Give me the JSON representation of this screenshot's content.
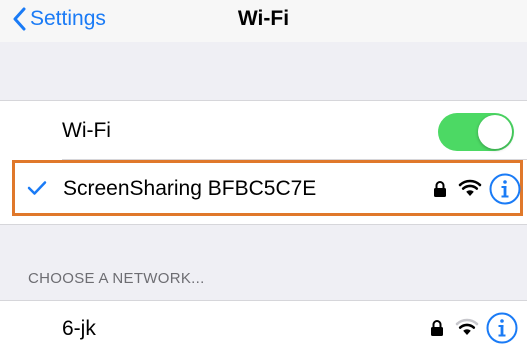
{
  "nav": {
    "back_label": "Settings",
    "title": "Wi-Fi"
  },
  "wifi_toggle": {
    "label": "Wi-Fi",
    "on": true,
    "color": "#4cd964"
  },
  "connected_network": {
    "name": "ScreenSharing BFBC5C7E",
    "secured": true,
    "icons": [
      "checkmark-icon",
      "lock-icon",
      "wifi-signal-icon",
      "info-icon"
    ],
    "highlight_color": "#e0782a"
  },
  "network_section": {
    "header": "CHOOSE A NETWORK..."
  },
  "networks": [
    {
      "name": "6-jk",
      "secured": true,
      "signal_bars": 2,
      "icons": [
        "lock-icon",
        "wifi-signal-icon",
        "info-icon"
      ]
    }
  ],
  "colors": {
    "accent": "#1a7bf6",
    "background": "#efeff4"
  }
}
